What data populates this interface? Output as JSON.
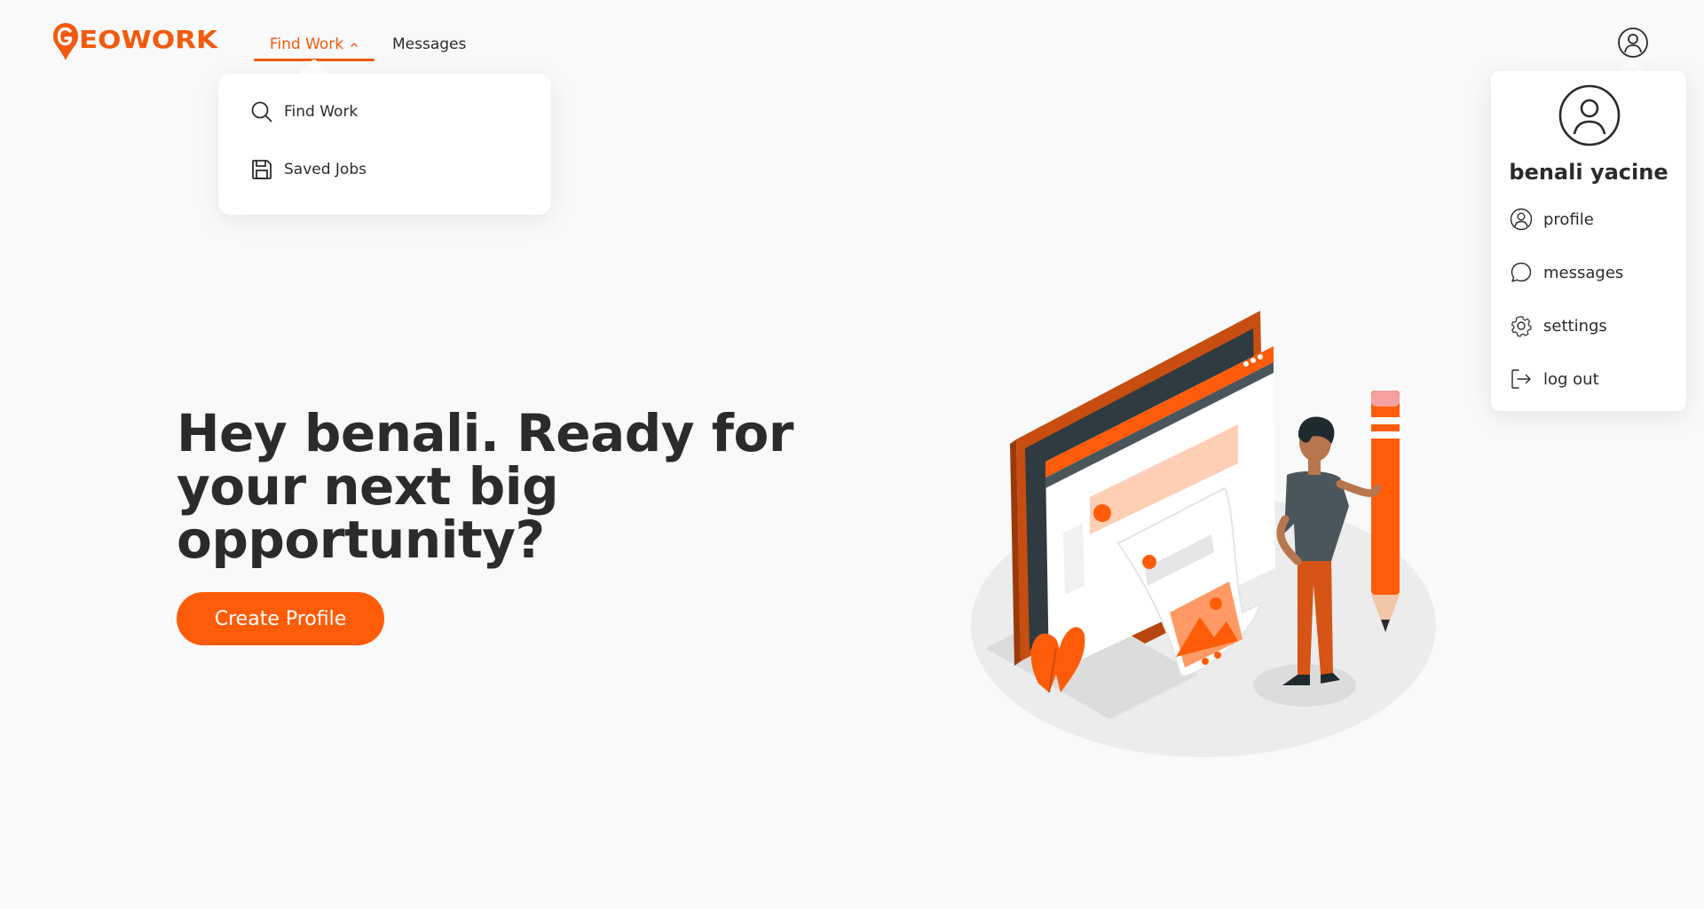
{
  "brand": {
    "name": "GEOWORK",
    "color": "#f25a0d"
  },
  "nav": {
    "find_work_label": "Find Work",
    "messages_label": "Messages"
  },
  "find_work_menu": {
    "items": [
      {
        "label": "Find Work",
        "icon": "search-icon"
      },
      {
        "label": "Saved Jobs",
        "icon": "save-icon"
      }
    ]
  },
  "user_menu": {
    "name": "benali yacine",
    "items": [
      {
        "label": "profile",
        "icon": "user-circle-icon"
      },
      {
        "label": "messages",
        "icon": "chat-bubble-icon"
      },
      {
        "label": "settings",
        "icon": "gear-icon"
      },
      {
        "label": "log out",
        "icon": "logout-icon"
      }
    ]
  },
  "hero": {
    "line1": "Hey benali. Ready for",
    "line2": "your next big",
    "line3": "opportunity?",
    "cta_label": "Create Profile"
  },
  "colors": {
    "accent": "#ff5c0a",
    "text": "#2b2b2b",
    "background": "#f9f9f9"
  }
}
